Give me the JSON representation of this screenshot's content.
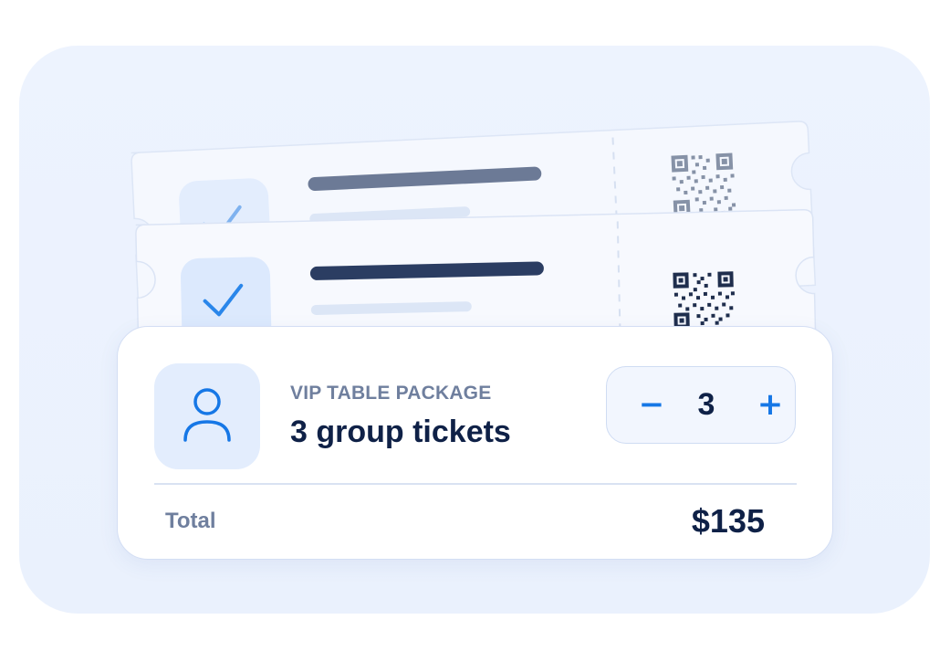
{
  "ticket_pass": {
    "package_label": "VIP TABLE PACKAGE",
    "title": "3 group tickets",
    "stepper": {
      "decrement_symbol": "−",
      "quantity": "3",
      "increment_symbol": "+"
    },
    "total_label": "Total",
    "total_value": "$135"
  },
  "colors": {
    "accent": "#1677e6",
    "text_primary": "#0f2147",
    "text_secondary": "#6f7f9e",
    "backdrop": "#ecf2fd"
  },
  "icons": [
    "checkmark-icon",
    "qr-code-icon",
    "user-icon",
    "minus-icon",
    "plus-icon"
  ]
}
